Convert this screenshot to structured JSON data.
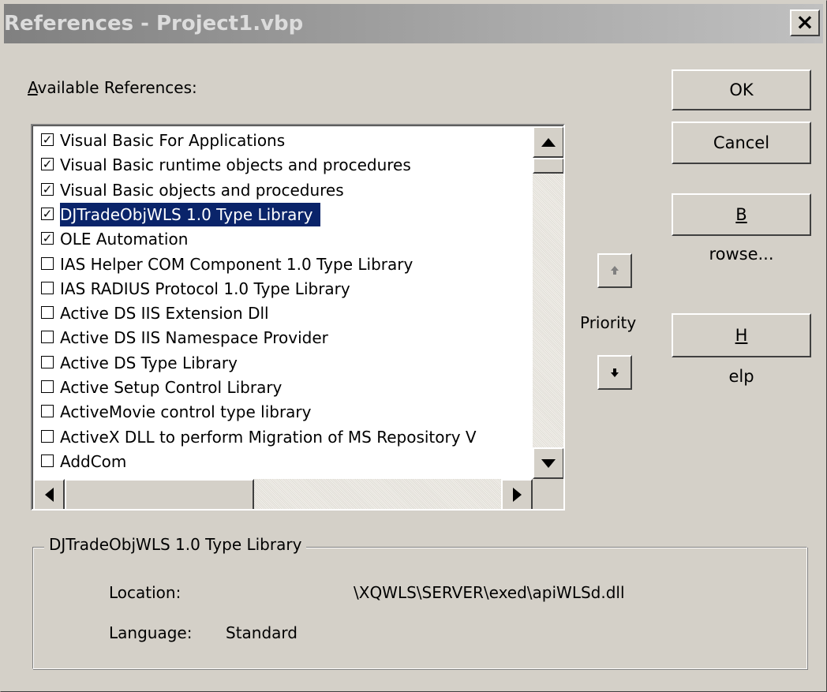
{
  "window": {
    "title": "References - Project1.vbp",
    "close_label": "×"
  },
  "available_label_prefix": "A",
  "available_label_rest": "vailable References:",
  "references": [
    {
      "label": "Visual Basic For Applications",
      "checked": true
    },
    {
      "label": "Visual Basic runtime objects and procedures",
      "checked": true
    },
    {
      "label": "Visual Basic objects and procedures",
      "checked": true
    },
    {
      "label": "DJTradeObjWLS 1.0 Type Library",
      "checked": true,
      "selected": true
    },
    {
      "label": "OLE Automation",
      "checked": true
    },
    {
      "label": " IAS Helper COM Component 1.0 Type Library",
      "checked": false
    },
    {
      "label": " IAS RADIUS Protocol 1.0 Type Library",
      "checked": false
    },
    {
      "label": "Active DS IIS Extension Dll",
      "checked": false
    },
    {
      "label": "Active DS IIS Namespace Provider",
      "checked": false
    },
    {
      "label": "Active DS Type Library",
      "checked": false
    },
    {
      "label": "Active Setup Control Library",
      "checked": false
    },
    {
      "label": "ActiveMovie control type library",
      "checked": false
    },
    {
      "label": "ActiveX DLL to perform Migration of MS Repository V",
      "checked": false
    },
    {
      "label": "AddCom",
      "checked": false
    }
  ],
  "buttons": {
    "ok": "OK",
    "cancel": "Cancel",
    "browse_prefix": "B",
    "browse_rest": "rowse...",
    "help_prefix": "H",
    "help_rest": "elp"
  },
  "priority_label": "Priority",
  "details": {
    "title": "DJTradeObjWLS 1.0 Type Library",
    "location_label": "Location:",
    "location_value": "\\XQWLS\\SERVER\\exed\\apiWLSd.dll",
    "language_label": "Language:",
    "language_value": "Standard"
  }
}
